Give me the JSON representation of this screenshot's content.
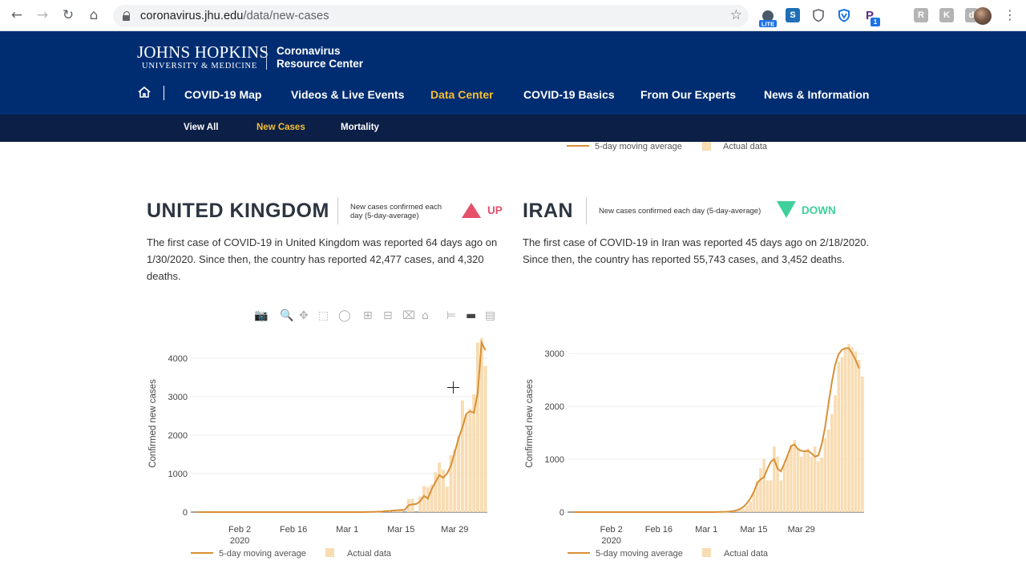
{
  "browser": {
    "url_host": "coronavirus.jhu.edu",
    "url_path": "/data/new-cases",
    "extensions": [
      "LITE",
      "S",
      "shield",
      "V",
      "P",
      "1",
      "R",
      "K",
      "d"
    ]
  },
  "site": {
    "logo_line1": "Johns Hopkins",
    "logo_line2": "University & Medicine",
    "resource_line1": "Coronavirus",
    "resource_line2": "Resource Center",
    "nav": [
      {
        "label": "COVID-19 Map"
      },
      {
        "label": "Videos & Live Events"
      },
      {
        "label": "Data Center"
      },
      {
        "label": "COVID-19 Basics"
      },
      {
        "label": "From Our Experts"
      },
      {
        "label": "News & Information"
      }
    ],
    "subnav": [
      {
        "label": "View All"
      },
      {
        "label": "New Cases"
      },
      {
        "label": "Mortality"
      }
    ]
  },
  "colors": {
    "header_bg": "#002d72",
    "subnav_bg": "#0c1f46",
    "active_nav": "#f7bf33",
    "line": "#d79036",
    "bar": "#f8dcb2",
    "up": "#e5506b",
    "down": "#3fd09b"
  },
  "legend": {
    "line_label": "5-day moving average",
    "bar_label": "Actual data"
  },
  "countries": [
    {
      "name": "UNITED KINGDOM",
      "trend_label": "New cases confirmed each day (5-day-average)",
      "trend": "UP",
      "description": "The first case of COVID-19 in United Kingdom was reported 64 days ago on 1/30/2020. Since then, the country has reported 42,477 cases, and 4,320 deaths."
    },
    {
      "name": "IRAN",
      "trend_label": "New cases confirmed each day (5-day-average)",
      "trend": "DOWN",
      "description": "The first case of COVID-19 in Iran was reported 45 days ago on 2/18/2020. Since then, the country has reported 55,743 cases, and 3,452 deaths."
    }
  ],
  "chart_data": [
    {
      "type": "bar",
      "title": "",
      "ylabel": "Confirmed new cases",
      "xlabel": "",
      "ylim": [
        0,
        4600
      ],
      "yticks": [
        "0",
        "1000",
        "2000",
        "3000",
        "4000"
      ],
      "xticks": [
        "Feb 2",
        "Feb 16",
        "Mar 1",
        "Mar 15",
        "Mar 29"
      ],
      "xtick_sub": "2020",
      "series": [
        {
          "name": "Actual data",
          "type": "bar",
          "start_date": "2020-01-22",
          "values": [
            0,
            0,
            0,
            0,
            0,
            0,
            0,
            0,
            2,
            0,
            0,
            0,
            0,
            0,
            0,
            0,
            0,
            1,
            0,
            0,
            0,
            0,
            0,
            0,
            0,
            0,
            0,
            0,
            0,
            0,
            0,
            0,
            0,
            0,
            0,
            0,
            0,
            4,
            0,
            0,
            0,
            0,
            2,
            0,
            5,
            13,
            3,
            12,
            30,
            50,
            50,
            40,
            52,
            83,
            0,
            343,
            342,
            0,
            407,
            676,
            643,
            714,
            1035,
            1285,
            1098,
            660,
            1480,
            1630,
            1973,
            2904,
            2539,
            2680,
            3060,
            4400,
            4520,
            3800
          ]
        },
        {
          "name": "5-day moving average",
          "type": "line",
          "start_date": "2020-01-22",
          "values": [
            0,
            0,
            0,
            0,
            0,
            0,
            0,
            0,
            0,
            0,
            0,
            0,
            0,
            0,
            0,
            0,
            0,
            0,
            0,
            0,
            0,
            0,
            0,
            0,
            0,
            0,
            0,
            0,
            0,
            0,
            0,
            0,
            0,
            0,
            0,
            0,
            0,
            0,
            0,
            0,
            0,
            0,
            0,
            0,
            2,
            4,
            6,
            10,
            15,
            22,
            31,
            40,
            46,
            52,
            57,
            180,
            200,
            210,
            280,
            420,
            350,
            600,
            780,
            960,
            890,
            1000,
            1200,
            1550,
            1920,
            2200,
            2550,
            2620,
            2580,
            3100,
            4400,
            4200
          ]
        }
      ]
    },
    {
      "type": "bar",
      "title": "",
      "ylabel": "Confirmed new cases",
      "xlabel": "",
      "ylim": [
        0,
        3350
      ],
      "yticks": [
        "0",
        "1000",
        "2000",
        "3000"
      ],
      "xticks": [
        "Feb 2",
        "Feb 16",
        "Mar 1",
        "Mar 15",
        "Mar 29"
      ],
      "xtick_sub": "2020",
      "series": [
        {
          "name": "Actual data",
          "type": "bar",
          "start_date": "2020-01-22",
          "values": [
            0,
            0,
            0,
            0,
            0,
            0,
            0,
            0,
            0,
            0,
            0,
            0,
            0,
            0,
            0,
            0,
            0,
            0,
            0,
            0,
            0,
            0,
            0,
            0,
            0,
            0,
            0,
            0,
            0,
            0,
            0,
            0,
            0,
            0,
            0,
            0,
            0,
            0,
            0,
            0,
            0,
            0,
            3,
            0,
            0,
            10,
            0,
            15,
            30,
            45,
            60,
            120,
            200,
            380,
            590,
            830,
            1000,
            600,
            600,
            1240,
            1050,
            600,
            900,
            1075,
            1270,
            1365,
            1210,
            1050,
            1150,
            1200,
            1045,
            1240,
            965,
            1030,
            1400,
            1560,
            1860,
            2210,
            2840,
            2930,
            3110,
            3180,
            3120,
            3040,
            2880,
            2560
          ]
        },
        {
          "name": "5-day moving average",
          "type": "line",
          "start_date": "2020-01-22",
          "values": [
            0,
            0,
            0,
            0,
            0,
            0,
            0,
            0,
            0,
            0,
            0,
            0,
            0,
            0,
            0,
            0,
            0,
            0,
            0,
            0,
            0,
            0,
            0,
            0,
            0,
            0,
            0,
            0,
            0,
            0,
            0,
            0,
            0,
            0,
            0,
            0,
            0,
            0,
            0,
            0,
            0,
            0,
            2,
            3,
            5,
            8,
            12,
            20,
            35,
            60,
            100,
            170,
            260,
            380,
            550,
            620,
            660,
            820,
            950,
            1000,
            820,
            770,
            920,
            1080,
            1250,
            1280,
            1190,
            1160,
            1150,
            1160,
            1110,
            1050,
            1070,
            1280,
            1600,
            2050,
            2460,
            2790,
            2990,
            3070,
            3100,
            3100,
            3000,
            2880,
            2720
          ]
        }
      ]
    }
  ]
}
